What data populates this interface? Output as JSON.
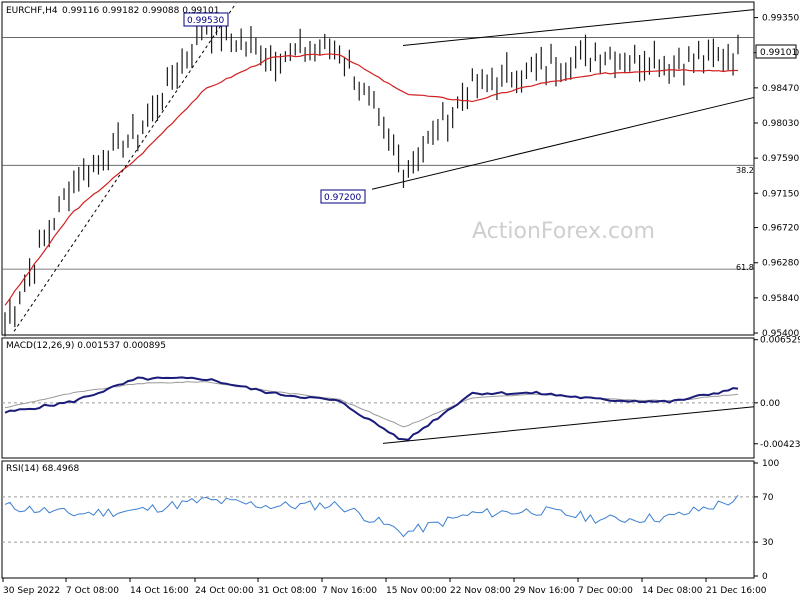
{
  "header": {
    "symbol": "EURCHF,H4",
    "ohlc": "0.99116 0.99182 0.99088 0.99101"
  },
  "watermark": "ActionForex.com",
  "price_axis": {
    "ticks": [
      "0.99350",
      "0.98910",
      "0.98470",
      "0.98030",
      "0.97590",
      "0.97150",
      "0.96720",
      "0.96280",
      "0.95840",
      "0.95400"
    ],
    "last_price": "0.99101"
  },
  "fib_levels": {
    "f382": "38.2",
    "f618": "61.8"
  },
  "callouts": {
    "high": "0.99530",
    "low": "0.97200"
  },
  "macd": {
    "title": "MACD(12,26,9) 0.001537 0.000895",
    "ticks": [
      "0.006529",
      "0.00",
      "-0.004233"
    ]
  },
  "rsi": {
    "title": "RSI(14) 68.4968",
    "ticks": [
      "100",
      "70",
      "30",
      "0"
    ]
  },
  "time_axis": {
    "ticks": [
      "30 Sep 2022",
      "7 Oct 08:00",
      "14 Oct 16:00",
      "24 Oct 00:00",
      "31 Oct 08:00",
      "7 Nov 16:00",
      "15 Nov 00:00",
      "22 Nov 08:00",
      "29 Nov 16:00",
      "7 Dec 00:00",
      "14 Dec 08:00",
      "21 Dec 16:00"
    ]
  },
  "colors": {
    "bars": "#1a1a1a",
    "ma": "#d21f1f",
    "macd_line": "#1b1b7a",
    "signal_line": "#9a9a9a",
    "rsi_line": "#3d7fd1",
    "trendline": "#000000",
    "grid": "#9a9a9a"
  },
  "chart_data": [
    {
      "type": "line",
      "title": "EURCHF,H4",
      "ylim": [
        0.954,
        0.9952
      ],
      "x": [
        "30 Sep 2022",
        "7 Oct 08:00",
        "14 Oct 16:00",
        "24 Oct 00:00",
        "31 Oct 08:00",
        "7 Nov 16:00",
        "15 Nov 00:00",
        "22 Nov 08:00",
        "29 Nov 16:00",
        "7 Dec 00:00",
        "14 Dec 08:00",
        "21 Dec 16:00"
      ],
      "series": [
        {
          "values": [
            0.955,
            0.973,
            0.979,
            0.9925,
            0.9885,
            0.99,
            0.974,
            0.985,
            0.987,
            0.989,
            0.988,
            0.989
          ]
        },
        {
          "values": [
            0.9575,
            0.969,
            0.976,
            0.9845,
            0.9885,
            0.989,
            0.984,
            0.983,
            0.9852,
            0.9865,
            0.987,
            0.9868
          ]
        }
      ]
    },
    {
      "type": "line",
      "title": "MACD(12,26,9) 0.001537 0.000895",
      "ylim": [
        -0.0055,
        0.0065
      ],
      "x": [
        "30 Sep 2022",
        "7 Oct 08:00",
        "14 Oct 16:00",
        "24 Oct 00:00",
        "31 Oct 08:00",
        "7 Nov 16:00",
        "15 Nov 00:00",
        "22 Nov 08:00",
        "29 Nov 16:00",
        "7 Dec 00:00",
        "14 Dec 08:00",
        "21 Dec 16:00"
      ],
      "series": [
        {
          "values": [
            -0.001,
            0.0001,
            0.0025,
            0.0025,
            0.001,
            0.0002,
            -0.004,
            0.001,
            0.001,
            0.0003,
            0.0001,
            0.0015
          ]
        },
        {
          "values": [
            -0.0005,
            0.001,
            0.002,
            0.0022,
            0.0012,
            0.0004,
            -0.0025,
            0.0005,
            0.0009,
            0.0004,
            0.0002,
            0.0009
          ]
        }
      ]
    },
    {
      "type": "line",
      "title": "RSI(14) 68.4968",
      "ylim": [
        0,
        100
      ],
      "x": [
        "30 Sep 2022",
        "7 Oct 08:00",
        "14 Oct 16:00",
        "24 Oct 00:00",
        "31 Oct 08:00",
        "7 Nov 16:00",
        "15 Nov 00:00",
        "22 Nov 08:00",
        "29 Nov 16:00",
        "7 Dec 00:00",
        "14 Dec 08:00",
        "21 Dec 16:00"
      ],
      "series": [
        {
          "values": [
            62,
            55,
            58,
            67,
            62,
            63,
            38,
            55,
            58,
            50,
            52,
            68
          ]
        }
      ]
    }
  ]
}
